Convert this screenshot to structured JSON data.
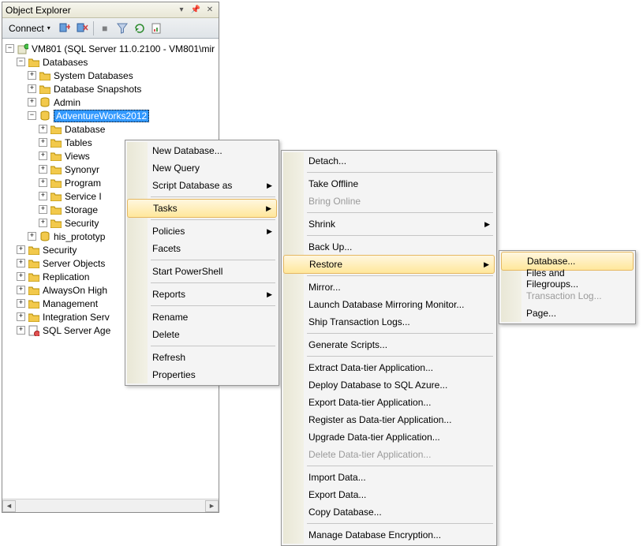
{
  "panel": {
    "title": "Object Explorer"
  },
  "toolbar": {
    "connect": "Connect"
  },
  "tree": {
    "server": "VM801 (SQL Server 11.0.2100 - VM801\\mir",
    "databases": "Databases",
    "sysdb": "System Databases",
    "dbsnap": "Database Snapshots",
    "admin": "Admin",
    "aw": "AdventureWorks2012",
    "aw_children": {
      "dbd": "Database",
      "tbl": "Tables",
      "vw": "Views",
      "syn": "Synonyr",
      "prog": "Program",
      "srvb": "Service I",
      "stor": "Storage",
      "sec": "Security"
    },
    "hisproto": "his_prototyp",
    "security": "Security",
    "srvobj": "Server Objects",
    "repl": "Replication",
    "aohigh": "AlwaysOn High",
    "mgmt": "Management",
    "intsrv": "Integration Serv",
    "sqlagent": "SQL Server Age"
  },
  "menu1": {
    "newdb": "New Database...",
    "newq": "New Query",
    "scriptdb": "Script Database as",
    "tasks": "Tasks",
    "policies": "Policies",
    "facets": "Facets",
    "powershell": "Start PowerShell",
    "reports": "Reports",
    "rename": "Rename",
    "delete": "Delete",
    "refresh": "Refresh",
    "properties": "Properties"
  },
  "menu2": {
    "detach": "Detach...",
    "takeoff": "Take Offline",
    "bringon": "Bring Online",
    "shrink": "Shrink",
    "backup": "Back Up...",
    "restore": "Restore",
    "mirror": "Mirror...",
    "launchmir": "Launch Database Mirroring Monitor...",
    "shiptx": "Ship Transaction Logs...",
    "genscr": "Generate Scripts...",
    "extract": "Extract Data-tier Application...",
    "deploy": "Deploy Database to SQL Azure...",
    "exportdac": "Export Data-tier Application...",
    "register": "Register as Data-tier Application...",
    "upgrade": "Upgrade Data-tier Application...",
    "deletedac": "Delete Data-tier Application...",
    "import": "Import Data...",
    "export": "Export Data...",
    "copydb": "Copy Database...",
    "mde": "Manage Database Encryption..."
  },
  "menu3": {
    "database": "Database...",
    "filesfg": "Files and Filegroups...",
    "txlog": "Transaction Log...",
    "page": "Page..."
  }
}
